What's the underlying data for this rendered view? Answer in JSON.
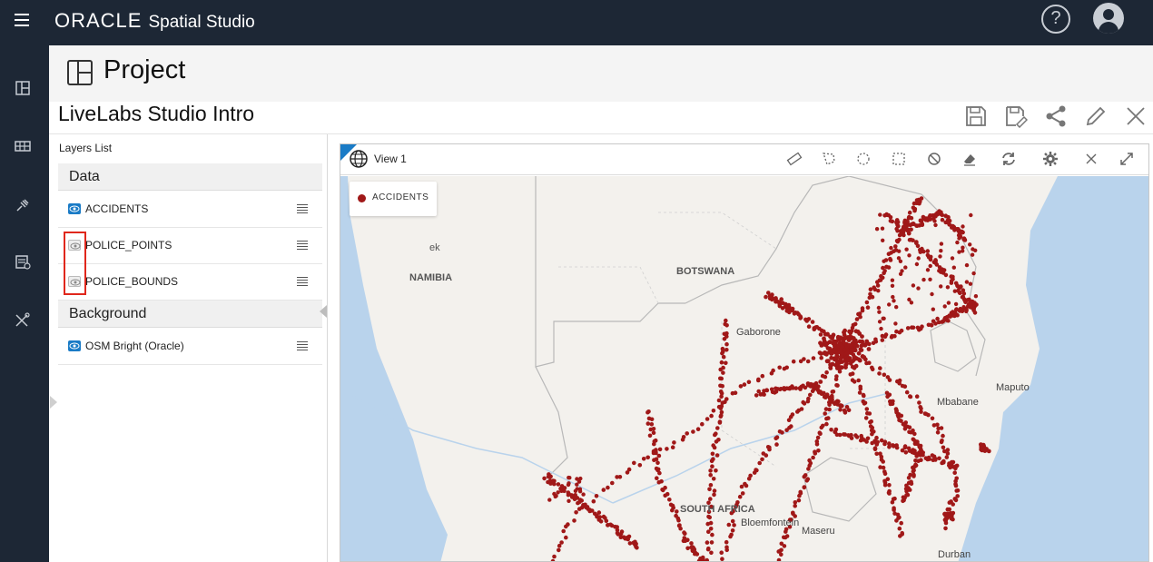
{
  "app": {
    "brand": "ORACLE",
    "product": "Spatial Studio",
    "help_glyph": "?"
  },
  "rail": {
    "icons": [
      "dashboard-icon",
      "table-icon",
      "plug-icon",
      "dataset-list-icon",
      "tools-icon"
    ]
  },
  "project": {
    "heading": "Project",
    "name": "LiveLabs Studio Intro",
    "toolbar_icons": [
      "save-icon",
      "save-as-icon",
      "share-icon",
      "edit-icon",
      "close-icon"
    ]
  },
  "layers_panel": {
    "title": "Layers List",
    "groups": [
      {
        "label": "Data",
        "layers": [
          {
            "name": "ACCIDENTS",
            "visible": true
          },
          {
            "name": "POLICE_POINTS",
            "visible": false
          },
          {
            "name": "POLICE_BOUNDS",
            "visible": false
          }
        ]
      },
      {
        "label": "Background",
        "layers": [
          {
            "name": "OSM Bright (Oracle)",
            "visible": true
          }
        ]
      }
    ]
  },
  "view": {
    "title": "View 1",
    "toolbar_icons": [
      "ruler-icon",
      "lasso-select-icon",
      "circle-select-icon",
      "rectangle-select-icon",
      "no-select-icon",
      "eraser-icon",
      "refresh-icon",
      "gear-icon",
      "close-icon",
      "expand-icon"
    ],
    "legend": {
      "label": "ACCIDENTS",
      "color": "#a01818"
    },
    "map_labels": {
      "namibia": "NAMIBIA",
      "botswana": "BOTSWANA",
      "south_africa": "SOUTH AFRICA",
      "gaborone": "Gaborone",
      "maputo": "Maputo",
      "mbabane": "Mbabane",
      "maseru": "Maseru",
      "bloemfontein": "Bloemfontein",
      "durban": "Durban",
      "windhoek_partial": "ek"
    }
  },
  "colors": {
    "topbar": "#1d2735",
    "accent": "#1a7bc6",
    "points": "#a01818",
    "highlight": "#e0271c",
    "land": "#f3f1ed",
    "water": "#b9d3ec"
  }
}
